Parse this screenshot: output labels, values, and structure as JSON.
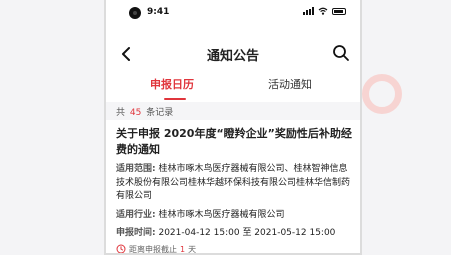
{
  "status_bar": {
    "time": "9:41"
  },
  "nav": {
    "title": "通知公告"
  },
  "tabs": [
    {
      "label": "申报日历",
      "active": true
    },
    {
      "label": "活动通知",
      "active": false
    }
  ],
  "records": {
    "prefix": "共",
    "count": "45",
    "suffix": "条记录"
  },
  "notice": {
    "title": "关于申报 2020年度“瞪羚企业”奖励性后补助经费的通知",
    "scope_label": "适用范围:",
    "scope_value": "桂林市啄木鸟医疗器械有限公司、桂林智神信息技术股份有限公司桂林华越环保科技有限公司桂林华信制药有限公司",
    "industry_label": "适用行业:",
    "industry_value": "桂林市啄木鸟医疗器械有限公司",
    "time_label": "申报时间:",
    "time_value": "2021-04-12 15:00 至 2021-05-12 15:00",
    "deadline_prefix": "距离申报截止",
    "deadline_days": "1",
    "deadline_suffix": "天"
  },
  "colors": {
    "accent": "#e0353c",
    "ring": "#f7d4d2"
  },
  "icons": [
    "camera-icon",
    "signal-icon",
    "wifi-icon",
    "battery-icon",
    "back-arrow-icon",
    "search-icon",
    "clock-icon"
  ]
}
